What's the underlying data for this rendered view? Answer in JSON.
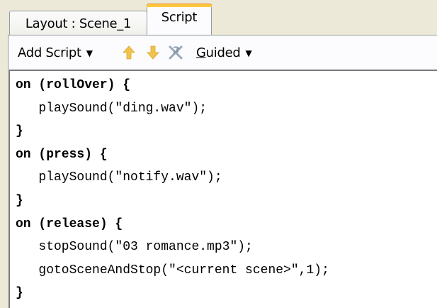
{
  "tabs": [
    {
      "label": "Layout : Scene_1",
      "active": false
    },
    {
      "label": "Script",
      "active": true
    }
  ],
  "toolbar": {
    "add_script_label": "Add Script",
    "guided_accel": "G",
    "guided_rest": "uided",
    "icons": [
      "arrow-up-icon",
      "arrow-down-icon",
      "delete-script-icon"
    ]
  },
  "code_lines": [
    {
      "text": "on (rollOver) {",
      "bold": true
    },
    {
      "text": "   playSound(\"ding.wav\");",
      "bold": false
    },
    {
      "text": "}",
      "bold": true
    },
    {
      "text": "on (press) {",
      "bold": true
    },
    {
      "text": "   playSound(\"notify.wav\");",
      "bold": false
    },
    {
      "text": "}",
      "bold": true
    },
    {
      "text": "on (release) {",
      "bold": true
    },
    {
      "text": "   stopSound(\"03 romance.mp3\");",
      "bold": false
    },
    {
      "text": "   gotoSceneAndStop(\"<current scene>\",1);",
      "bold": false
    },
    {
      "text": "}",
      "bold": true
    }
  ],
  "colors": {
    "tab_highlight": "#ffc83c",
    "arrow_icon": "#f2c34a",
    "panel_bg": "#ece9d8"
  }
}
